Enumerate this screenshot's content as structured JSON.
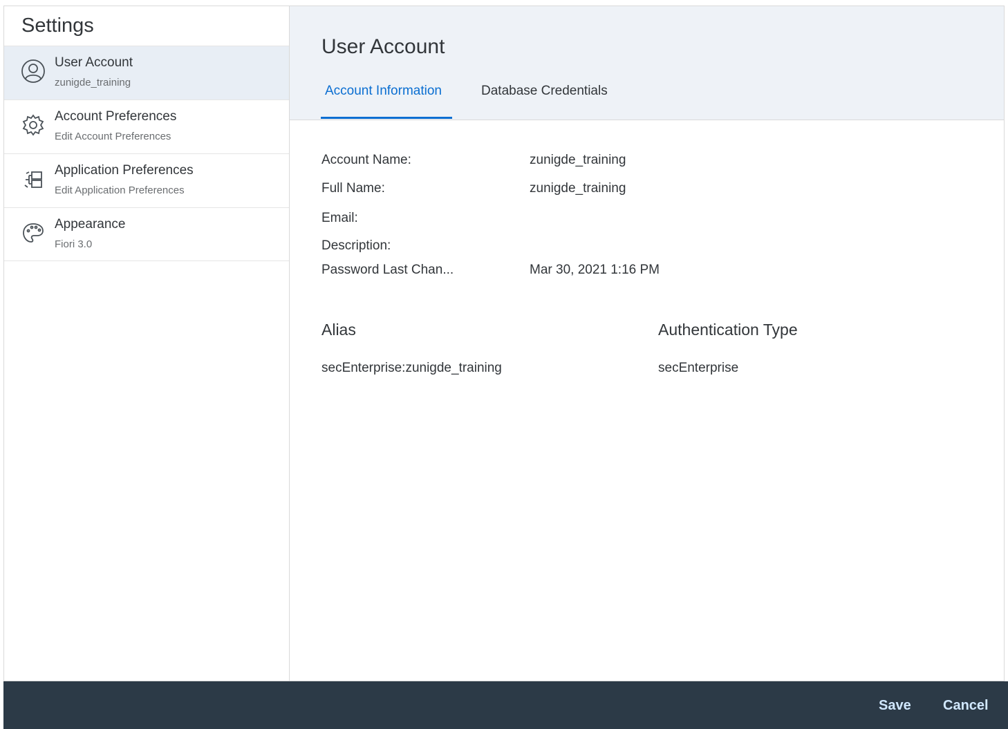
{
  "sidebar": {
    "title": "Settings",
    "items": [
      {
        "label": "User Account",
        "desc": "zunigde_training",
        "icon": "user-account-icon"
      },
      {
        "label": "Account Preferences",
        "desc": "Edit Account Preferences",
        "icon": "gear-icon"
      },
      {
        "label": "Application Preferences",
        "desc": "Edit Application Preferences",
        "icon": "application-preferences-icon"
      },
      {
        "label": "Appearance",
        "desc": "Fiori 3.0",
        "icon": "palette-icon"
      }
    ]
  },
  "main": {
    "title": "User Account",
    "tabs": [
      {
        "label": "Account Information",
        "active": true
      },
      {
        "label": "Database Credentials",
        "active": false
      }
    ],
    "fields": [
      {
        "label": "Account Name:",
        "value": "zunigde_training"
      },
      {
        "label": "Full Name:",
        "value": "zunigde_training"
      },
      {
        "label": "Email:",
        "value": ""
      },
      {
        "label": "Description:",
        "value": ""
      },
      {
        "label": "Password Last Chan...",
        "value": "Mar 30, 2021 1:16 PM"
      }
    ],
    "alias": {
      "header": "Alias",
      "value": "secEnterprise:zunigde_training"
    },
    "auth_type": {
      "header": "Authentication Type",
      "value": "secEnterprise"
    }
  },
  "footer": {
    "save_label": "Save",
    "cancel_label": "Cancel"
  },
  "colors": {
    "accent": "#0a6ed1",
    "selected_bg": "#e8eef5",
    "header_bg": "#eef2f7",
    "footer_bg": "#2c3a47"
  }
}
